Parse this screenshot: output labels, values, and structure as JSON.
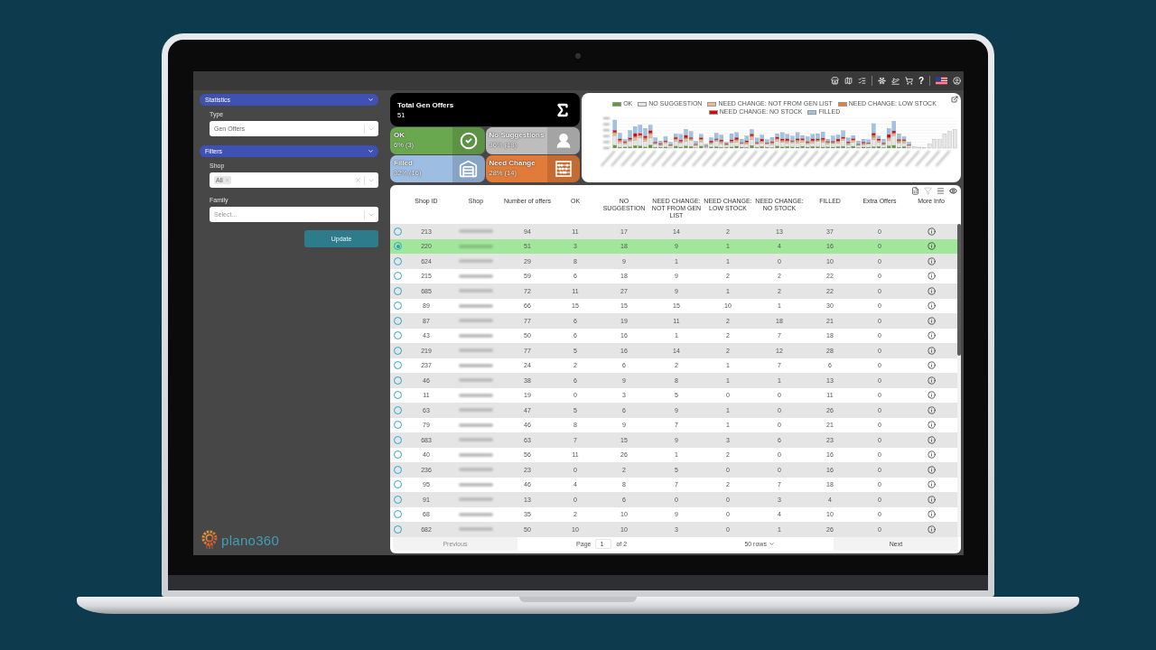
{
  "top_bar": {
    "help_label": "?"
  },
  "sidebar": {
    "sections": [
      {
        "title": "Statistics",
        "expanded": true,
        "fields": [
          {
            "kind": "select",
            "label": "Type",
            "value": "Gen Offers"
          }
        ]
      },
      {
        "title": "Filters",
        "expanded": true,
        "fields": [
          {
            "kind": "multiselect",
            "label": "Shop",
            "chips": [
              "All"
            ]
          },
          {
            "kind": "select",
            "label": "Family",
            "placeholder": "Select..."
          }
        ]
      }
    ],
    "update_button": "Update",
    "logo": "plano360"
  },
  "summary": {
    "total": {
      "title": "Total Gen Offers",
      "value": "51"
    },
    "cards": [
      {
        "kind": "ok",
        "title": "OK",
        "value": "6% (3)",
        "color": "#6aa84f"
      },
      {
        "kind": "no_suggestion",
        "title": "No Suggestions",
        "value": "36% (18)",
        "color": "#bdbdbd"
      },
      {
        "kind": "filled",
        "title": "Filled",
        "value": "32% (16)",
        "color": "#9dbde3"
      },
      {
        "kind": "need_change",
        "title": "Need Change",
        "value": "28% (14)",
        "color": "#e07b39"
      }
    ]
  },
  "chart": {
    "legend": [
      {
        "label": "OK",
        "color": "#5e9e32"
      },
      {
        "label": "NO SUGGESTION",
        "color": "#e6e6e6"
      },
      {
        "label": "NEED CHANGE: NOT FROM GEN LIST",
        "color": "#f4b98a"
      },
      {
        "label": "NEED CHANGE: LOW STOCK",
        "color": "#e67e3a"
      },
      {
        "label": "NEED CHANGE: NO STOCK",
        "color": "#e3000f"
      },
      {
        "label": "FILLED",
        "color": "#9fc3e7"
      }
    ]
  },
  "table": {
    "columns": [
      "Shop ID",
      "Shop",
      "Number of offers",
      "OK",
      "NO SUGGESTION",
      "NEED CHANGE: NOT FROM GEN LIST",
      "NEED CHANGE: LOW STOCK",
      "NEED CHANGE: NO STOCK",
      "FILLED",
      "Extra Offers",
      "More Info"
    ],
    "rows": [
      {
        "selected": false,
        "cells": [
          "213",
          "",
          "94",
          "11",
          "17",
          "14",
          "2",
          "13",
          "37",
          "0"
        ]
      },
      {
        "selected": true,
        "cells": [
          "220",
          "",
          "51",
          "3",
          "18",
          "9",
          "1",
          "4",
          "16",
          "0"
        ]
      },
      {
        "selected": false,
        "cells": [
          "624",
          "",
          "29",
          "8",
          "9",
          "1",
          "1",
          "0",
          "10",
          "0"
        ]
      },
      {
        "selected": false,
        "cells": [
          "215",
          "",
          "59",
          "6",
          "18",
          "9",
          "2",
          "2",
          "22",
          "0"
        ]
      },
      {
        "selected": false,
        "cells": [
          "685",
          "",
          "72",
          "11",
          "27",
          "9",
          "1",
          "2",
          "22",
          "0"
        ]
      },
      {
        "selected": false,
        "cells": [
          "89",
          "",
          "66",
          "15",
          "15",
          "15",
          "10",
          "1",
          "30",
          "0"
        ]
      },
      {
        "selected": false,
        "cells": [
          "87",
          "",
          "77",
          "6",
          "19",
          "11",
          "2",
          "18",
          "21",
          "0"
        ]
      },
      {
        "selected": false,
        "cells": [
          "43",
          "",
          "50",
          "6",
          "16",
          "1",
          "2",
          "7",
          "18",
          "0"
        ]
      },
      {
        "selected": false,
        "cells": [
          "219",
          "",
          "77",
          "5",
          "16",
          "14",
          "2",
          "12",
          "28",
          "0"
        ]
      },
      {
        "selected": false,
        "cells": [
          "237",
          "",
          "24",
          "2",
          "6",
          "2",
          "1",
          "7",
          "6",
          "0"
        ]
      },
      {
        "selected": false,
        "cells": [
          "46",
          "",
          "38",
          "6",
          "9",
          "8",
          "1",
          "1",
          "13",
          "0"
        ]
      },
      {
        "selected": false,
        "cells": [
          "11",
          "",
          "19",
          "0",
          "3",
          "5",
          "0",
          "0",
          "11",
          "0"
        ]
      },
      {
        "selected": false,
        "cells": [
          "63",
          "",
          "47",
          "5",
          "6",
          "9",
          "1",
          "0",
          "26",
          "0"
        ]
      },
      {
        "selected": false,
        "cells": [
          "79",
          "",
          "46",
          "8",
          "9",
          "7",
          "1",
          "0",
          "21",
          "0"
        ]
      },
      {
        "selected": false,
        "cells": [
          "683",
          "",
          "63",
          "7",
          "15",
          "9",
          "3",
          "6",
          "23",
          "0"
        ]
      },
      {
        "selected": false,
        "cells": [
          "40",
          "",
          "56",
          "11",
          "26",
          "1",
          "2",
          "0",
          "16",
          "0"
        ]
      },
      {
        "selected": false,
        "cells": [
          "236",
          "",
          "23",
          "0",
          "2",
          "5",
          "0",
          "0",
          "16",
          "0"
        ]
      },
      {
        "selected": false,
        "cells": [
          "95",
          "",
          "46",
          "4",
          "8",
          "7",
          "2",
          "7",
          "18",
          "0"
        ]
      },
      {
        "selected": false,
        "cells": [
          "91",
          "",
          "13",
          "0",
          "6",
          "0",
          "0",
          "3",
          "4",
          "0"
        ]
      },
      {
        "selected": false,
        "cells": [
          "68",
          "",
          "35",
          "2",
          "10",
          "9",
          "0",
          "4",
          "10",
          "0"
        ]
      },
      {
        "selected": false,
        "cells": [
          "682",
          "",
          "50",
          "10",
          "10",
          "3",
          "0",
          "1",
          "26",
          "0"
        ]
      }
    ]
  },
  "pagination": {
    "previous": {
      "label": "Previous",
      "disabled": true
    },
    "page_label": "Page",
    "page": "1",
    "page_count": "of 2",
    "rows_per_page": "50 rows",
    "next": {
      "label": "Next",
      "disabled": false
    }
  }
}
